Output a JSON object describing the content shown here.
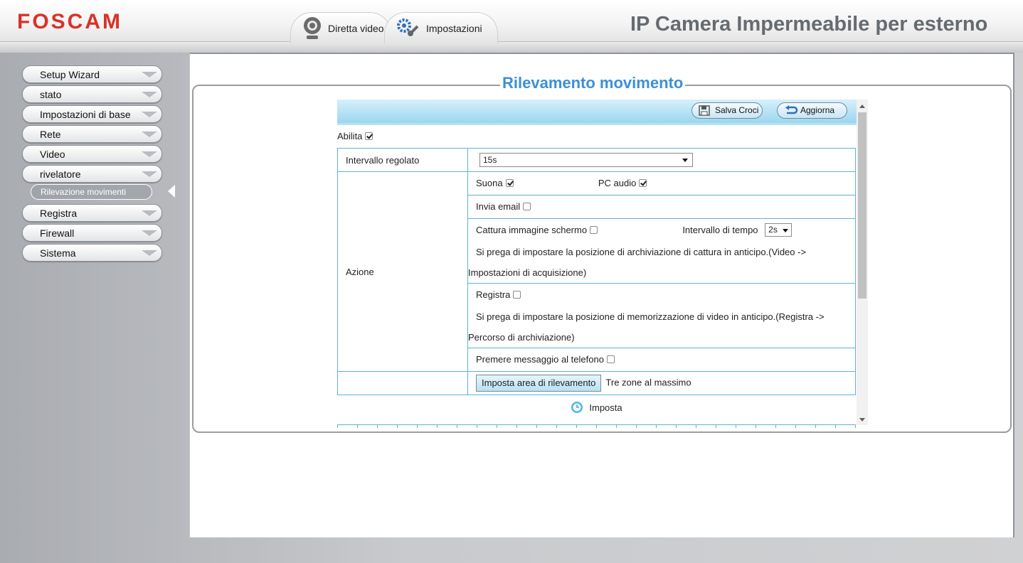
{
  "header": {
    "logo": "FOSCAM",
    "product_title": "IP Camera Impermeabile per esterno",
    "tabs": [
      {
        "label": "Diretta video",
        "icon": "webcam-icon"
      },
      {
        "label": "Impostazioni",
        "icon": "gears-icon"
      }
    ]
  },
  "sidebar": {
    "items": [
      {
        "label": "Setup Wizard"
      },
      {
        "label": "stato"
      },
      {
        "label": "Impostazioni di base"
      },
      {
        "label": "Rete"
      },
      {
        "label": "Video"
      },
      {
        "label": "rivelatore"
      },
      {
        "label": "Registra"
      },
      {
        "label": "Firewall"
      },
      {
        "label": "Sistema"
      }
    ],
    "subitem": "Rilevazione movimenti"
  },
  "main": {
    "title": "Rilevamento movimento",
    "toolbar": {
      "save": "Salva Croci",
      "refresh": "Aggiorna"
    },
    "enable": {
      "label": "Abilita",
      "checked": true
    },
    "interval": {
      "label": "Intervallo regolato",
      "value": "15s"
    },
    "action": {
      "label": "Azione",
      "sound": {
        "label": "Suona",
        "checked": true
      },
      "pc_audio": {
        "label": "PC audio",
        "checked": true
      },
      "email": {
        "label": "Invia email",
        "checked": false
      },
      "snapshot": {
        "label": "Cattura immagine schermo",
        "checked": false
      },
      "time_interval": {
        "label": "Intervallo di tempo",
        "value": "2s"
      },
      "snapshot_note_1": "Si prega di impostare la posizione di archiviazione di cattura in anticipo.(Video ->",
      "snapshot_note_2": "Impostazioni di acquisizione)",
      "record": {
        "label": "Registra",
        "checked": false
      },
      "record_note_1": "Si prega di impostare la posizione di memorizzazione di video in anticipo.(Registra ->",
      "record_note_2": "Percorso di archiviazione)",
      "push": {
        "label": "Premere messaggio al telefono",
        "checked": false
      }
    },
    "detection_area": {
      "button": "Imposta area di rilevamento",
      "note": "Tre zone al massimo"
    },
    "schedule": {
      "label": "Imposta"
    }
  },
  "colors": {
    "accent": "#3d8fd6",
    "logo": "#d8322a",
    "table_border": "#5bb3d8"
  }
}
